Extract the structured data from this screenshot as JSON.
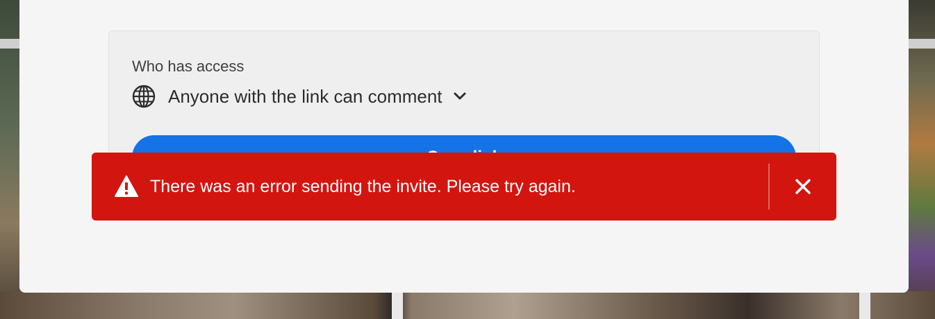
{
  "dialog": {
    "access": {
      "label": "Who has access",
      "value": "Anyone with the link can comment",
      "icon": "globe-icon",
      "dropdown_icon": "chevron-down-icon"
    },
    "primary_button": {
      "label": "Copy link"
    }
  },
  "toast": {
    "variant": "negative",
    "icon": "alert-triangle-icon",
    "message": "There was an error sending the invite. Please try again.",
    "close_icon": "close-icon",
    "colors": {
      "background": "#d31510",
      "text": "#ffffff"
    }
  },
  "colors": {
    "accent": "#1473e6",
    "dialog_bg": "#f5f5f5"
  }
}
